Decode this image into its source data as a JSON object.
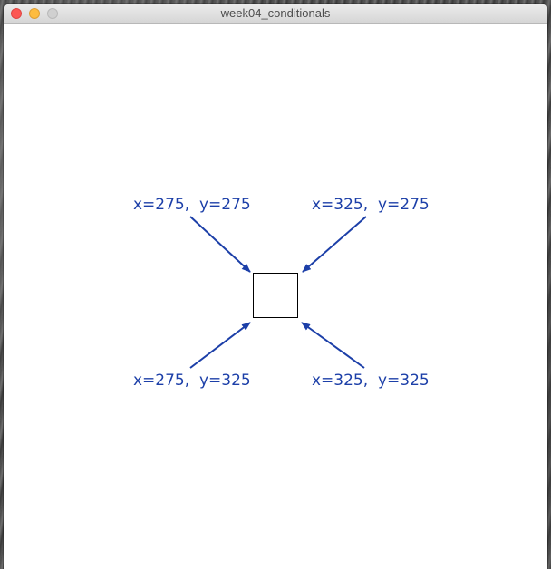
{
  "window": {
    "title": "week04_conditionals"
  },
  "colors": {
    "annotation": "#1c3fa8",
    "rect_stroke": "#000000",
    "canvas_background": "#ffffff"
  },
  "labels": {
    "top_left": "x=275,  y=275",
    "top_right": "x=325,  y=275",
    "bottom_left": "x=275,  y=325",
    "bottom_right": "x=325,  y=325"
  }
}
